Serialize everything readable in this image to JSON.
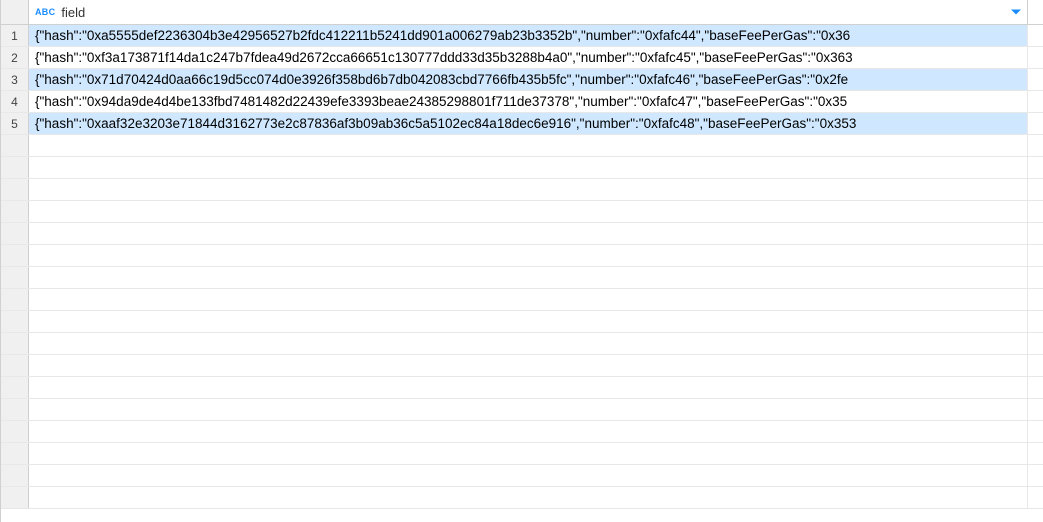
{
  "column": {
    "type_badge": "ABC",
    "name": "field"
  },
  "rows": [
    {
      "num": "1",
      "value": "{\"hash\":\"0xa5555def2236304b3e42956527b2fdc412211b5241dd901a006279ab23b3352b\",\"number\":\"0xfafc44\",\"baseFeePerGas\":\"0x36",
      "selected": true
    },
    {
      "num": "2",
      "value": "{\"hash\":\"0xf3a173871f14da1c247b7fdea49d2672cca66651c130777ddd33d35b3288b4a0\",\"number\":\"0xfafc45\",\"baseFeePerGas\":\"0x363",
      "selected": false
    },
    {
      "num": "3",
      "value": "{\"hash\":\"0x71d70424d0aa66c19d5cc074d0e3926f358bd6b7db042083cbd7766fb435b5fc\",\"number\":\"0xfafc46\",\"baseFeePerGas\":\"0x2fe",
      "selected": true
    },
    {
      "num": "4",
      "value": "{\"hash\":\"0x94da9de4d4be133fbd7481482d22439efe3393beae24385298801f711de37378\",\"number\":\"0xfafc47\",\"baseFeePerGas\":\"0x35",
      "selected": false
    },
    {
      "num": "5",
      "value": "{\"hash\":\"0xaaf32e3203e71844d3162773e2c87836af3b09ab36c5a5102ec84a18dec6e916\",\"number\":\"0xfafc48\",\"baseFeePerGas\":\"0x353",
      "selected": true
    }
  ],
  "empty_row_count": 17
}
